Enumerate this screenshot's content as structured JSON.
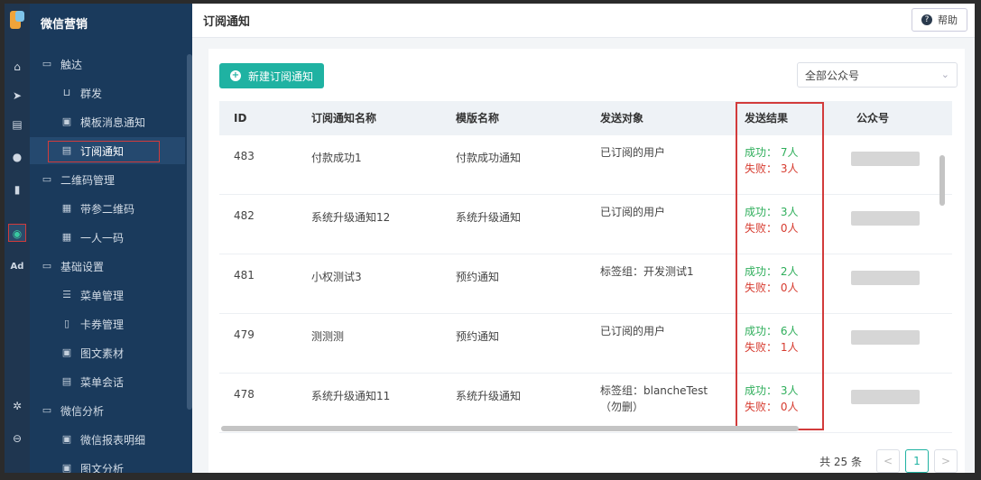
{
  "sidebar": {
    "brand": "微信营销",
    "items": [
      {
        "label": "触达",
        "icon": "folder-icon",
        "kind": "group"
      },
      {
        "label": "群发",
        "icon": "broadcast-icon",
        "kind": "sub"
      },
      {
        "label": "模板消息通知",
        "icon": "template-icon",
        "kind": "sub"
      },
      {
        "label": "订阅通知",
        "icon": "subscribe-icon",
        "kind": "sub",
        "active": true
      },
      {
        "label": "二维码管理",
        "icon": "folder-icon",
        "kind": "group"
      },
      {
        "label": "带参二维码",
        "icon": "qrcode-icon",
        "kind": "sub"
      },
      {
        "label": "一人一码",
        "icon": "qrcode-icon",
        "kind": "sub"
      },
      {
        "label": "基础设置",
        "icon": "folder-icon",
        "kind": "group"
      },
      {
        "label": "菜单管理",
        "icon": "menu-list-icon",
        "kind": "sub"
      },
      {
        "label": "卡券管理",
        "icon": "card-icon",
        "kind": "sub"
      },
      {
        "label": "图文素材",
        "icon": "article-icon",
        "kind": "sub"
      },
      {
        "label": "菜单会话",
        "icon": "chat-icon",
        "kind": "sub"
      },
      {
        "label": "微信分析",
        "icon": "folder-icon",
        "kind": "group"
      },
      {
        "label": "微信报表明细",
        "icon": "report-icon",
        "kind": "sub"
      },
      {
        "label": "图文分析",
        "icon": "article-icon",
        "kind": "sub"
      }
    ]
  },
  "rail": {
    "ad_label": "Ad"
  },
  "header": {
    "title": "订阅通知",
    "help_label": "帮助"
  },
  "toolbar": {
    "new_label": "新建订阅通知",
    "account_select": "全部公众号"
  },
  "table": {
    "headers": [
      "ID",
      "订阅通知名称",
      "模版名称",
      "发送对象",
      "发送结果",
      "公众号"
    ],
    "rows": [
      {
        "id": "483",
        "name": "付款成功1",
        "template": "付款成功通知",
        "target": "已订阅的用户",
        "target2": "",
        "ok": "成功： 7人",
        "fail": "失败： 3人"
      },
      {
        "id": "482",
        "name": "系统升级通知12",
        "template": "系统升级通知",
        "target": "已订阅的用户",
        "target2": "",
        "ok": "成功： 3人",
        "fail": "失败： 0人"
      },
      {
        "id": "481",
        "name": "小权测试3",
        "template": "预约通知",
        "target": "标签组：开发测试1",
        "target2": "",
        "ok": "成功： 2人",
        "fail": "失败： 0人"
      },
      {
        "id": "479",
        "name": "测测测",
        "template": "预约通知",
        "target": "已订阅的用户",
        "target2": "",
        "ok": "成功： 6人",
        "fail": "失败： 1人"
      },
      {
        "id": "478",
        "name": "系统升级通知11",
        "template": "系统升级通知",
        "target": "标签组：blancheTest",
        "target2": "（勿删）",
        "ok": "成功： 3人",
        "fail": "失败： 0人"
      }
    ]
  },
  "pagination": {
    "total": "共 25 条",
    "current": "1",
    "prev": "<",
    "next": ">"
  }
}
